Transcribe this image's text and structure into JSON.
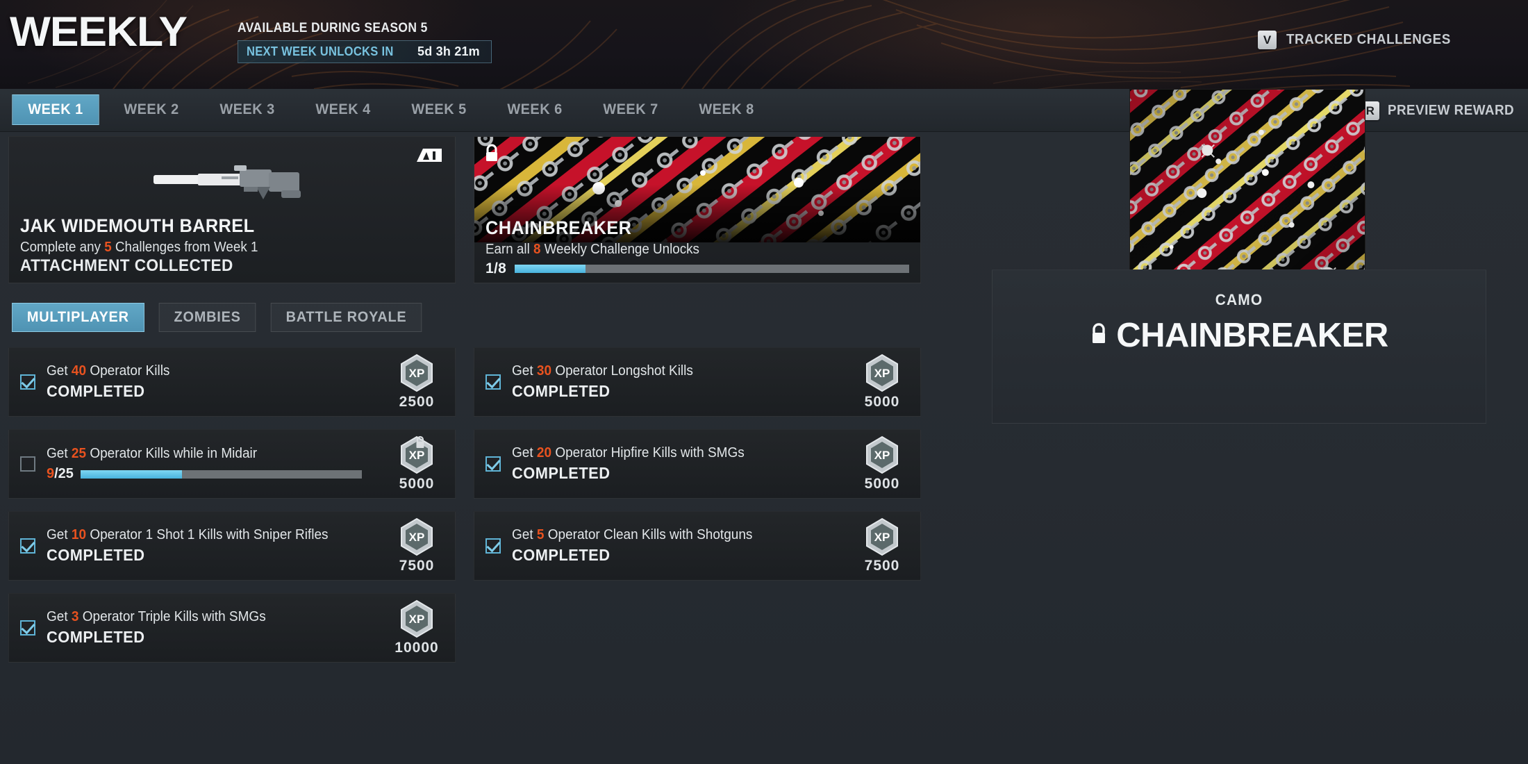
{
  "header": {
    "title": "WEEKLY",
    "available_label": "AVAILABLE DURING SEASON 5",
    "unlock_label": "NEXT WEEK UNLOCKS IN",
    "unlock_time": "5d 3h 21m",
    "tracked_key": "V",
    "tracked_label": "TRACKED CHALLENGES",
    "accent_blue": "#5fb4d6",
    "accent_orange": "#e8521f"
  },
  "tabbar": {
    "weeks": [
      {
        "label": "WEEK 1",
        "active": true
      },
      {
        "label": "WEEK 2",
        "active": false
      },
      {
        "label": "WEEK 3",
        "active": false
      },
      {
        "label": "WEEK 4",
        "active": false
      },
      {
        "label": "WEEK 5",
        "active": false
      },
      {
        "label": "WEEK 6",
        "active": false
      },
      {
        "label": "WEEK 7",
        "active": false
      },
      {
        "label": "WEEK 8",
        "active": false
      }
    ],
    "preview_key": "R",
    "preview_label": "PREVIEW REWARD"
  },
  "rewards": {
    "attachment": {
      "icon": "jak-logo-icon",
      "name": "JAK WIDEMOUTH BARREL",
      "requirement_prefix": "Complete any ",
      "requirement_count": "5",
      "requirement_suffix": " Challenges from Week 1",
      "status": "ATTACHMENT COLLECTED"
    },
    "camo": {
      "locked": true,
      "name": "CHAINBREAKER",
      "requirement_prefix": "Earn all ",
      "requirement_count": "8",
      "requirement_suffix": " Weekly Challenge Unlocks",
      "progress_text": "1/8",
      "progress_current": 1,
      "progress_total": 8,
      "progress_percent": 18
    }
  },
  "modes": [
    {
      "label": "MULTIPLAYER",
      "active": true
    },
    {
      "label": "ZOMBIES",
      "active": false
    },
    {
      "label": "BATTLE ROYALE",
      "active": false
    }
  ],
  "challenges": [
    {
      "column": "left",
      "completed": true,
      "locked": false,
      "desc_prefix": "Get ",
      "desc_count": "40",
      "desc_suffix": " Operator Kills",
      "status": "COMPLETED",
      "xp_icon": "xp-hex-icon",
      "xp": "2500"
    },
    {
      "column": "right",
      "completed": true,
      "locked": false,
      "desc_prefix": "Get ",
      "desc_count": "30",
      "desc_suffix": " Operator Longshot Kills",
      "status": "COMPLETED",
      "xp_icon": "xp-hex-icon",
      "xp": "5000"
    },
    {
      "column": "left",
      "completed": false,
      "locked": true,
      "desc_prefix": "Get ",
      "desc_count": "25",
      "desc_suffix": " Operator Kills while in Midair",
      "status": "",
      "progress_current": "9",
      "progress_total": "/25",
      "progress_percent": 36,
      "xp_icon": "xp-hex-icon",
      "xp": "5000"
    },
    {
      "column": "right",
      "completed": true,
      "locked": false,
      "desc_prefix": "Get ",
      "desc_count": "20",
      "desc_suffix": " Operator Hipfire Kills with SMGs",
      "status": "COMPLETED",
      "xp_icon": "xp-hex-icon",
      "xp": "5000"
    },
    {
      "column": "left",
      "completed": true,
      "locked": false,
      "desc_prefix": "Get ",
      "desc_count": "10",
      "desc_suffix": " Operator 1 Shot 1 Kills with Sniper Rifles",
      "status": "COMPLETED",
      "xp_icon": "xp-hex-icon",
      "xp": "7500"
    },
    {
      "column": "right",
      "completed": true,
      "locked": false,
      "desc_prefix": "Get ",
      "desc_count": "5",
      "desc_suffix": " Operator Clean Kills with Shotguns",
      "status": "COMPLETED",
      "xp_icon": "xp-hex-icon",
      "xp": "7500"
    },
    {
      "column": "left",
      "completed": true,
      "locked": false,
      "desc_prefix": "Get ",
      "desc_count": "3",
      "desc_suffix": " Operator Triple Kills with SMGs",
      "status": "COMPLETED",
      "xp_icon": "xp-hex-icon",
      "xp": "10000"
    }
  ],
  "preview": {
    "kicker": "CAMO",
    "name": "CHAINBREAKER",
    "locked": true
  }
}
